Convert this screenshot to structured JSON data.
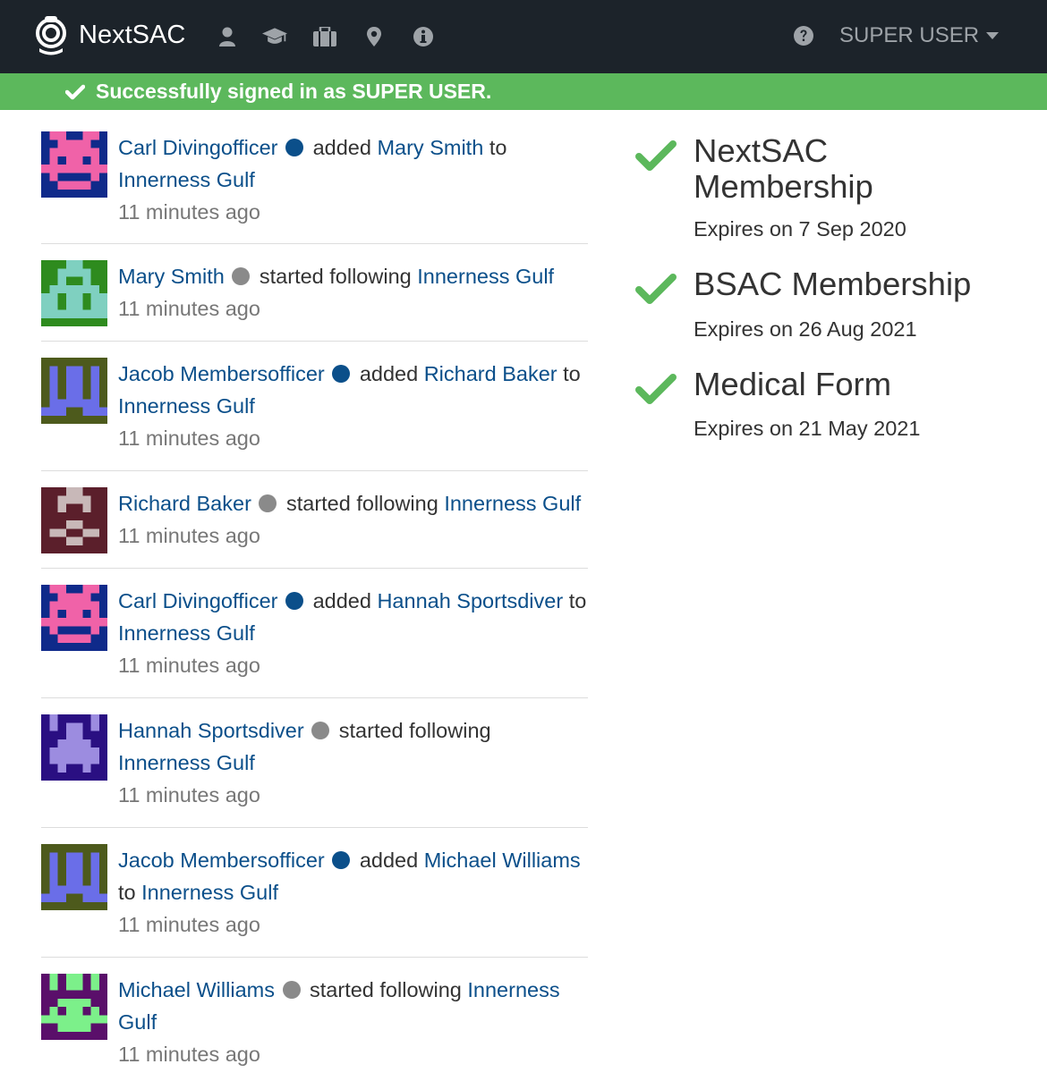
{
  "navbar": {
    "brand": "NextSAC",
    "user": "SUPER USER",
    "icons": [
      "user-icon",
      "graduation-cap-icon",
      "briefcase-icon",
      "map-marker-icon",
      "info-icon",
      "help-icon"
    ],
    "background": "#1c232a"
  },
  "flash": {
    "message": "Successfully signed in as SUPER USER.",
    "color": "#5cb85c"
  },
  "feed": {
    "items": [
      {
        "actor": "Carl Divingofficer",
        "role": "officer",
        "verb": "added",
        "object": "Mary Smith",
        "prep": "to",
        "target": "Innerness Gulf",
        "time": "11 minutes ago",
        "avatar": "pink-on-blue"
      },
      {
        "actor": "Mary Smith",
        "role": "member",
        "verb": "started following",
        "target": "Innerness Gulf",
        "time": "11 minutes ago",
        "avatar": "teal-on-green"
      },
      {
        "actor": "Jacob Membersofficer",
        "role": "officer",
        "verb": "added",
        "object": "Richard Baker",
        "prep": "to",
        "target": "Innerness Gulf",
        "time": "11 minutes ago",
        "avatar": "blue-on-olive"
      },
      {
        "actor": "Richard Baker",
        "role": "member",
        "verb": "started following",
        "target": "Innerness Gulf",
        "time": "11 minutes ago",
        "avatar": "grey-on-maroon"
      },
      {
        "actor": "Carl Divingofficer",
        "role": "officer",
        "verb": "added",
        "object": "Hannah Sportsdiver",
        "prep": "to",
        "target": "Innerness Gulf",
        "time": "11 minutes ago",
        "avatar": "pink-on-blue"
      },
      {
        "actor": "Hannah Sportsdiver",
        "role": "member",
        "verb": "started following",
        "target": "Innerness Gulf",
        "time": "11 minutes ago",
        "avatar": "lavender-on-indigo"
      },
      {
        "actor": "Jacob Membersofficer",
        "role": "officer",
        "verb": "added",
        "object": "Michael Williams",
        "prep": "to",
        "target": "Innerness Gulf",
        "time": "11 minutes ago",
        "avatar": "blue-on-olive"
      },
      {
        "actor": "Michael Williams",
        "role": "member",
        "verb": "started following",
        "target": "Innerness Gulf",
        "time": "11 minutes ago",
        "avatar": "green-on-purple"
      }
    ],
    "link_color": "#0b4f8a",
    "officer_dot_color": "#0b4f8a",
    "member_dot_color": "#8a8a8a"
  },
  "qualifications": [
    {
      "title": "NextSAC Membership",
      "expiry": "Expires on 7 Sep 2020"
    },
    {
      "title": "BSAC Membership",
      "expiry": "Expires on 26 Aug 2021"
    },
    {
      "title": "Medical Form",
      "expiry": "Expires on 21 May 2021"
    }
  ],
  "check_color": "#5cb85c"
}
